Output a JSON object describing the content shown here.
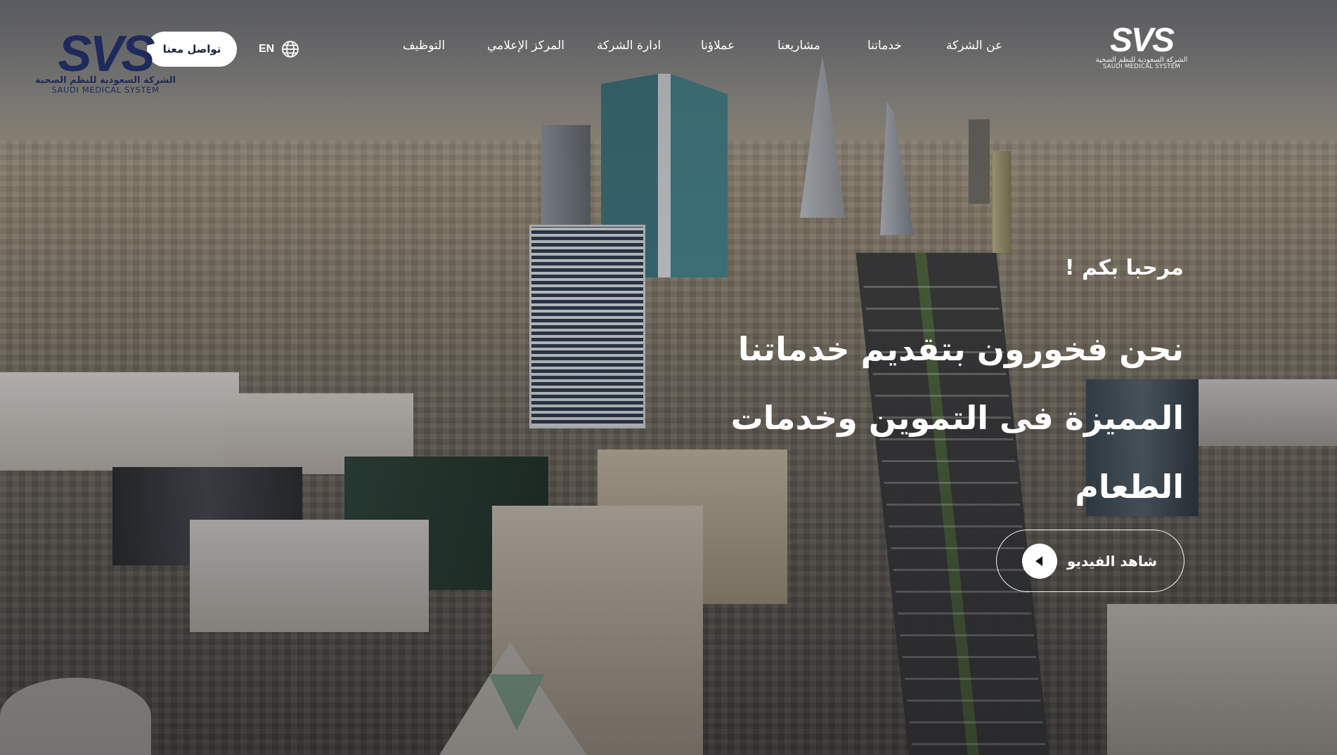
{
  "header": {
    "logo_right": {
      "mark": "SVS",
      "arabic": "الشركة السعودية للنظم الصحية",
      "english": "SAUDI MEDICAL SYSTEM"
    },
    "nav": [
      {
        "label": "عن الشركة"
      },
      {
        "label": "خدماتنا"
      },
      {
        "label": "مشاريعنا"
      },
      {
        "label": "عملاؤنا"
      },
      {
        "label": "ادارة الشركة"
      },
      {
        "label": "المركز الإعلامي"
      },
      {
        "label": "التوظيف"
      }
    ],
    "language": {
      "label": "EN",
      "icon": "globe-icon"
    },
    "contact_button": "تواصل معنا",
    "logo_left": {
      "mark": "SVS",
      "arabic": "الشركة السعودية للنظم الصحية",
      "english": "SAUDI MEDICAL SYSTEM"
    }
  },
  "hero": {
    "welcome": "مرحبا بكم !",
    "title_line1": "نحن فخورون بتقديم خدماتنا",
    "title_line2": "المميزة فى التموين وخدمات الطعام",
    "video_button": "شاهد الفيديو",
    "video_icon": "play-icon"
  },
  "colors": {
    "brand_navy": "#1f2a5c",
    "text_light": "#ffffff",
    "button_bg": "#ffffff"
  }
}
